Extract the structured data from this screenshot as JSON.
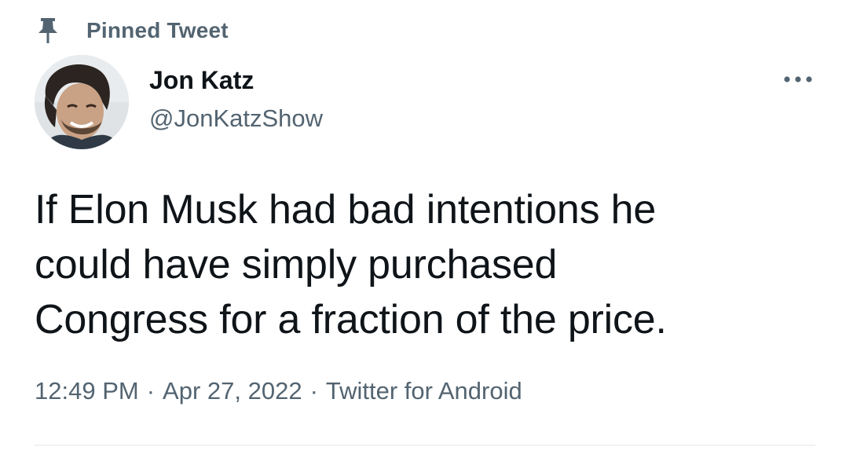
{
  "pinned": {
    "icon": "pin-icon",
    "label": "Pinned Tweet"
  },
  "author": {
    "name": "Jon Katz",
    "handle": "@JonKatzShow",
    "avatar": "avatar-photo"
  },
  "more_icon": "more-horizontal-icon",
  "tweet": {
    "text_lines": [
      "If Elon Musk had bad intentions he",
      "could have simply purchased",
      "Congress for a fraction of the price."
    ]
  },
  "meta": {
    "time": "12:49 PM",
    "separator": "·",
    "date": "Apr 27, 2022",
    "source": "Twitter for Android"
  },
  "colors": {
    "text_primary": "#0f1419",
    "text_secondary": "#536471",
    "divider": "#eff3f4"
  }
}
